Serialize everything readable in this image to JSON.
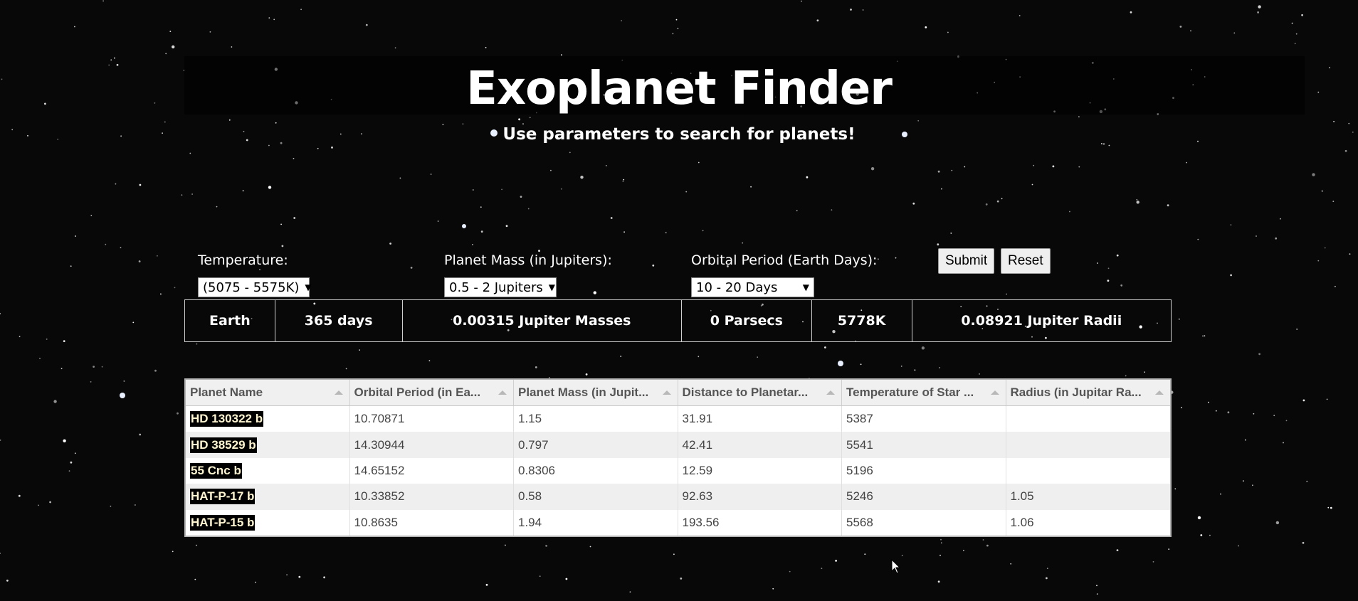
{
  "header": {
    "title": "Exoplanet Finder",
    "subtitle": "Use parameters to search for planets!"
  },
  "filters": {
    "temperature": {
      "label": "Temperature:",
      "value": "(5075 - 5575K)"
    },
    "mass": {
      "label": "Planet Mass (in Jupiters):",
      "value": "0.5 - 2 Jupiters"
    },
    "period": {
      "label": "Orbital Period (Earth Days):",
      "value": "10 - 20 Days"
    },
    "submit_label": "Submit",
    "reset_label": "Reset"
  },
  "earth_reference": {
    "name": "Earth",
    "period": "365 days",
    "mass": "0.00315 Jupiter Masses",
    "distance": "0 Parsecs",
    "temperature": "5778K",
    "radius": "0.08921 Jupiter Radii"
  },
  "grid": {
    "columns": [
      "Planet Name",
      "Orbital Period (in Ea...",
      "Planet Mass (in Jupit...",
      "Distance to Planetar...",
      "Temperature of Star ...",
      "Radius (in Jupitar Ra..."
    ],
    "rows": [
      {
        "name": "HD 130322 b",
        "period": "10.70871",
        "mass": "1.15",
        "distance": "31.91",
        "temp": "5387",
        "radius": ""
      },
      {
        "name": "HD 38529 b",
        "period": "14.30944",
        "mass": "0.797",
        "distance": "42.41",
        "temp": "5541",
        "radius": ""
      },
      {
        "name": "55 Cnc b",
        "period": "14.65152",
        "mass": "0.8306",
        "distance": "12.59",
        "temp": "5196",
        "radius": ""
      },
      {
        "name": "HAT-P-17 b",
        "period": "10.33852",
        "mass": "0.58",
        "distance": "92.63",
        "temp": "5246",
        "radius": "1.05"
      },
      {
        "name": "HAT-P-15 b",
        "period": "10.8635",
        "mass": "1.94",
        "distance": "193.56",
        "temp": "5568",
        "radius": "1.06"
      }
    ]
  },
  "colors": {
    "background": "#080808",
    "text": "#ffffff",
    "name_highlight_bg": "#000000",
    "name_highlight_fg": "#fff6d0"
  }
}
